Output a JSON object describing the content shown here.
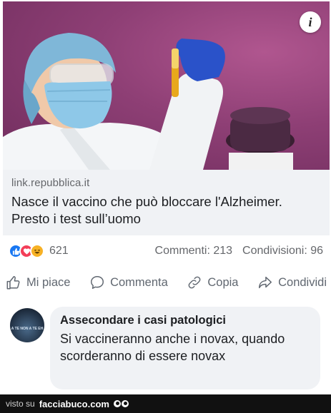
{
  "post": {
    "image": {
      "description_icon": "info-icon",
      "info_glyph": "i"
    },
    "link": {
      "domain": "link.repubblica.it",
      "headline": "Nasce il vaccino che può bloccare l'Alzheimer. Presto i test sull’uomo"
    },
    "reactions": {
      "types": [
        "like-icon",
        "love-icon",
        "haha-icon"
      ],
      "count": "621",
      "comments": "Commenti: 213",
      "shares": "Condivisioni: 96"
    },
    "actions": {
      "like": "Mi piace",
      "comment": "Commenta",
      "copy": "Copia",
      "share": "Condividi"
    }
  },
  "comment": {
    "author": "Assecondare i casi patologici",
    "avatar_text": "A TE NON A TE EH",
    "text": "Si vaccineranno anche i novax, quando scorderanno di essere novax"
  },
  "footer": {
    "seen_on": "visto su",
    "brand": "facciabuco.com"
  },
  "colors": {
    "background_purple": "#8e3f75",
    "preview_bg": "#f0f2f5",
    "like_blue": "#1877f2",
    "love_red": "#f33e58",
    "haha_yellow": "#f7b125",
    "muted_text": "#65676b"
  }
}
